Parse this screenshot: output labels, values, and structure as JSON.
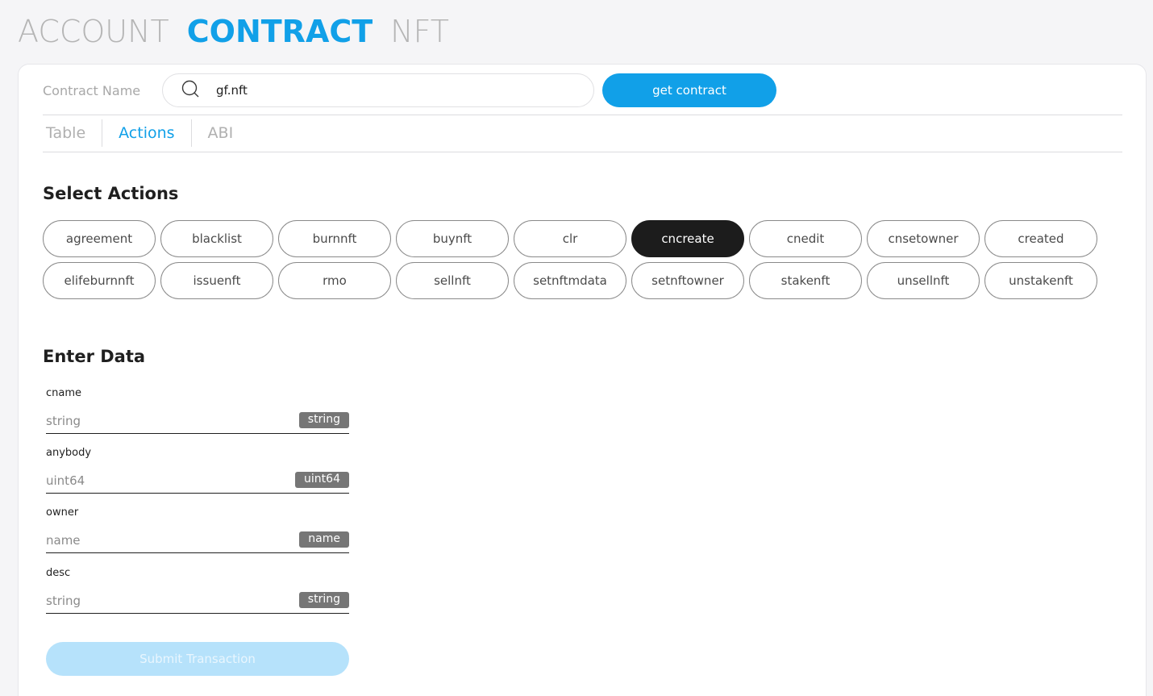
{
  "nav": {
    "items": [
      {
        "label": "ACCOUNT",
        "active": false
      },
      {
        "label": "CONTRACT",
        "active": true
      },
      {
        "label": "NFT",
        "active": false
      }
    ]
  },
  "contract": {
    "label": "Contract Name",
    "search_value": "gf.nft",
    "search_icon": "search-icon",
    "get_button": "get contract"
  },
  "tabs": [
    {
      "label": "Table",
      "active": false
    },
    {
      "label": "Actions",
      "active": true
    },
    {
      "label": "ABI",
      "active": false
    }
  ],
  "select_actions": {
    "title": "Select Actions",
    "selected": "cncreate",
    "items": [
      "agreement",
      "blacklist",
      "burnnft",
      "buynft",
      "clr",
      "cncreate",
      "cnedit",
      "cnsetowner",
      "created",
      "elifeburnnft",
      "issuenft",
      "rmo",
      "sellnft",
      "setnftmdata",
      "setnftowner",
      "stakenft",
      "unsellnft",
      "unstakenft"
    ]
  },
  "enter_data": {
    "title": "Enter Data",
    "fields": [
      {
        "label": "cname",
        "placeholder": "string",
        "type": "string"
      },
      {
        "label": "anybody",
        "placeholder": "uint64",
        "type": "uint64"
      },
      {
        "label": "owner",
        "placeholder": "name",
        "type": "name"
      },
      {
        "label": "desc",
        "placeholder": "string",
        "type": "string"
      }
    ],
    "submit": "Submit Transaction"
  },
  "colors": {
    "accent": "#11a0e8",
    "selected_pill": "#1c1c1c",
    "submit_disabled": "#b6e2fb",
    "badge": "#767676"
  }
}
